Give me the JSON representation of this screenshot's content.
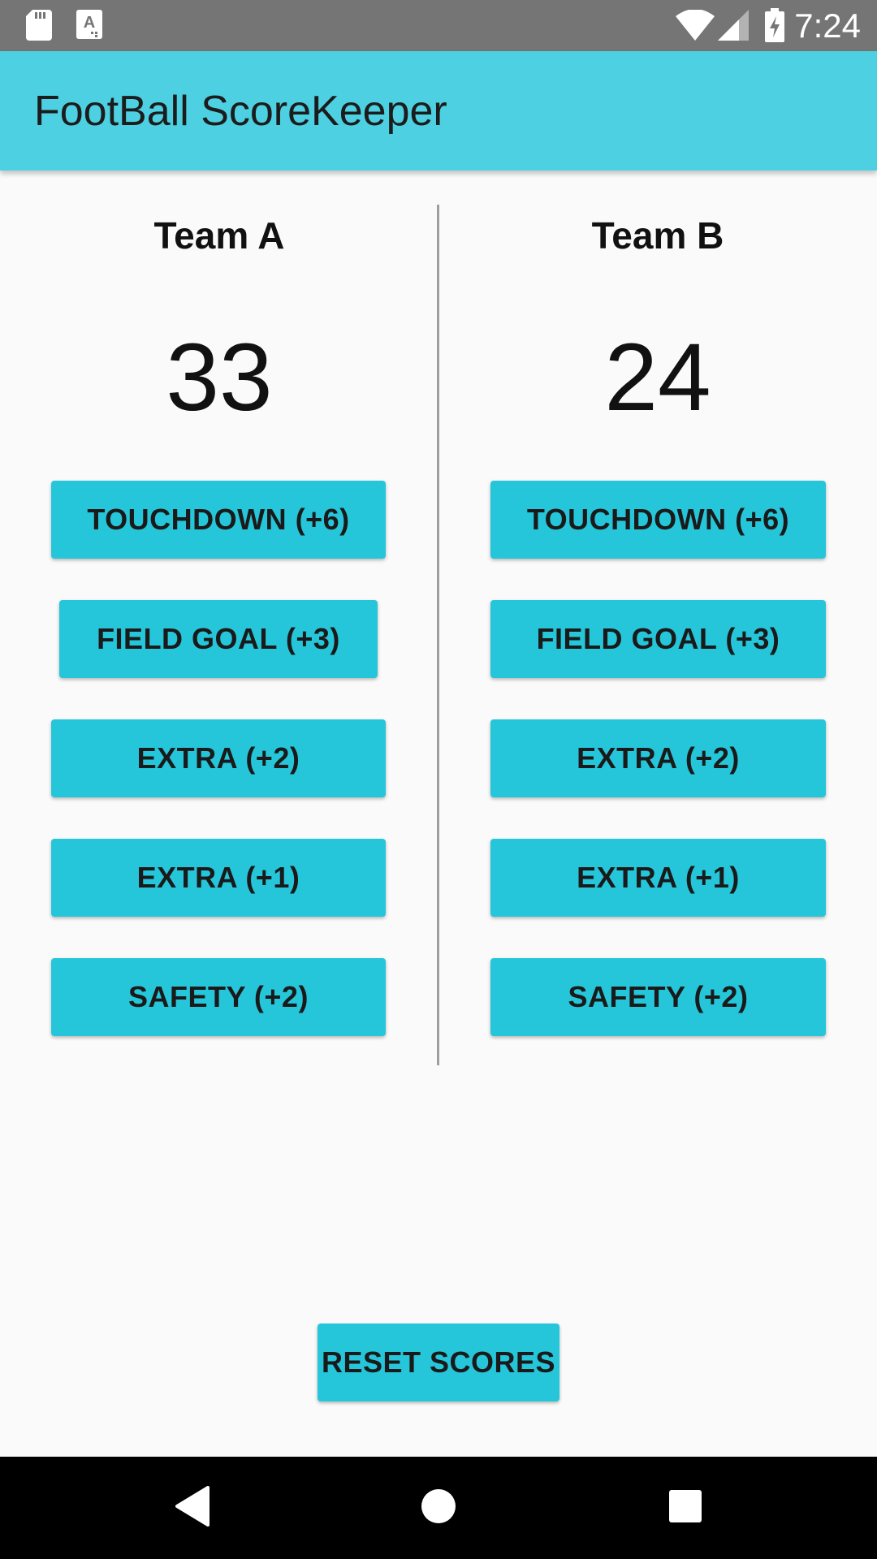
{
  "status_bar": {
    "time": "7:24",
    "icons": [
      "sd-card-icon",
      "font-a-icon",
      "wifi-icon",
      "signal-icon",
      "battery-charging-icon"
    ]
  },
  "app_bar": {
    "title": "FootBall ScoreKeeper"
  },
  "team_a": {
    "name": "Team A",
    "score": "33",
    "buttons": {
      "touchdown": "TOUCHDOWN (+6)",
      "field_goal": "FIELD GOAL (+3)",
      "extra2": "EXTRA (+2)",
      "extra1": "EXTRA (+1)",
      "safety": "SAFETY (+2)"
    }
  },
  "team_b": {
    "name": "Team B",
    "score": "24",
    "buttons": {
      "touchdown": "TOUCHDOWN (+6)",
      "field_goal": "FIELD GOAL (+3)",
      "extra2": "EXTRA (+2)",
      "extra1": "EXTRA (+1)",
      "safety": "SAFETY (+2)"
    }
  },
  "reset_label": "RESET SCORES",
  "colors": {
    "app_bar": "#4dd0e1",
    "button": "#26c6da",
    "status_bar": "#757575",
    "background": "#fafafa",
    "nav_bar": "#000000"
  },
  "nav_bar": {
    "icons": [
      "back-icon",
      "home-icon",
      "recents-icon"
    ]
  }
}
